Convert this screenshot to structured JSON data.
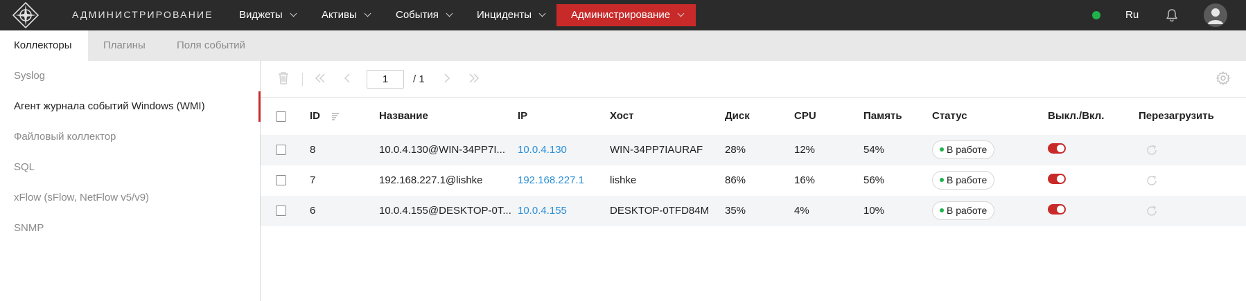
{
  "header": {
    "app_title": "АДМИНИСТРИРОВАНИЕ",
    "nav": [
      {
        "label": "Виджеты",
        "active": false
      },
      {
        "label": "Активы",
        "active": false
      },
      {
        "label": "События",
        "active": false
      },
      {
        "label": "Инциденты",
        "active": false
      },
      {
        "label": "Администрирование",
        "active": true
      }
    ],
    "language": "Ru",
    "status_color": "#21b24b",
    "accent_color": "#c82a2a"
  },
  "tabs": [
    {
      "label": "Коллекторы",
      "active": true
    },
    {
      "label": "Плагины",
      "active": false
    },
    {
      "label": "Поля событий",
      "active": false
    }
  ],
  "sidebar": {
    "items": [
      {
        "label": "Syslog",
        "active": false
      },
      {
        "label": "Агент журнала событий Windows (WMI)",
        "active": true
      },
      {
        "label": "Файловый коллектор",
        "active": false
      },
      {
        "label": "SQL",
        "active": false
      },
      {
        "label": "xFlow (sFlow, NetFlow v5/v9)",
        "active": false
      },
      {
        "label": "SNMP",
        "active": false
      }
    ]
  },
  "toolbar": {
    "icons": [
      "trash-icon",
      "first-page-icon",
      "prev-page-icon",
      "next-page-icon",
      "last-page-icon",
      "settings-icon"
    ],
    "page_value": "1",
    "page_total": "/ 1"
  },
  "table": {
    "columns": {
      "id": "ID",
      "name": "Название",
      "ip": "IP",
      "host": "Хост",
      "disk": "Диск",
      "cpu": "CPU",
      "memory": "Память",
      "status": "Статус",
      "onoff": "Выкл./Вкл.",
      "restart": "Перезагрузить"
    },
    "rows": [
      {
        "id": "8",
        "name": "10.0.4.130@WIN-34PP7I...",
        "ip": "10.0.4.130",
        "host": "WIN-34PP7IAURAF",
        "disk": "28%",
        "cpu": "12%",
        "memory": "54%",
        "status": "В работе",
        "enabled": true
      },
      {
        "id": "7",
        "name": "192.168.227.1@lishke",
        "ip": "192.168.227.1",
        "host": "lishke",
        "disk": "86%",
        "cpu": "16%",
        "memory": "56%",
        "status": "В работе",
        "enabled": true
      },
      {
        "id": "6",
        "name": "10.0.4.155@DESKTOP-0T...",
        "ip": "10.0.4.155",
        "host": "DESKTOP-0TFD84M",
        "disk": "35%",
        "cpu": "4%",
        "memory": "10%",
        "status": "В работе",
        "enabled": true
      }
    ]
  }
}
